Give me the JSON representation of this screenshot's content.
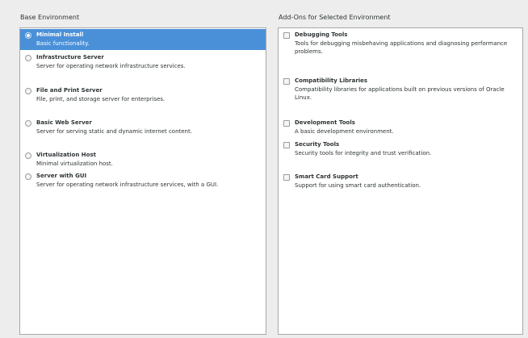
{
  "base_environment": {
    "title": "Base Environment",
    "options": [
      {
        "name": "Minimal Install",
        "desc": "Basic functionality.",
        "selected": true
      },
      {
        "name": "Infrastructure Server",
        "desc": "Server for operating network infrastructure services.",
        "selected": false
      },
      {
        "name": "File and Print Server",
        "desc": "File, print, and storage server for enterprises.",
        "selected": false
      },
      {
        "name": "Basic Web Server",
        "desc": "Server for serving static and dynamic internet content.",
        "selected": false
      },
      {
        "name": "Virtualization Host",
        "desc": "Minimal virtualization host.",
        "selected": false
      },
      {
        "name": "Server with GUI",
        "desc": "Server for operating network infrastructure services, with a GUI.",
        "selected": false
      }
    ]
  },
  "addons": {
    "title": "Add-Ons for Selected Environment",
    "options": [
      {
        "name": "Debugging Tools",
        "desc": "Tools for debugging misbehaving applications and diagnosing performance problems.",
        "checked": false
      },
      {
        "name": "Compatibility Libraries",
        "desc": "Compatibility libraries for applications built on previous versions of Oracle Linux.",
        "checked": false
      },
      {
        "name": "Development Tools",
        "desc": "A basic development environment.",
        "checked": false
      },
      {
        "name": "Security Tools",
        "desc": "Security tools for integrity and trust verification.",
        "checked": false
      },
      {
        "name": "Smart Card Support",
        "desc": "Support for using smart card authentication.",
        "checked": false
      }
    ]
  },
  "colors": {
    "selection": "#4a90d9",
    "background": "#ededed",
    "list_background": "#ffffff",
    "text": "#2e3436"
  }
}
